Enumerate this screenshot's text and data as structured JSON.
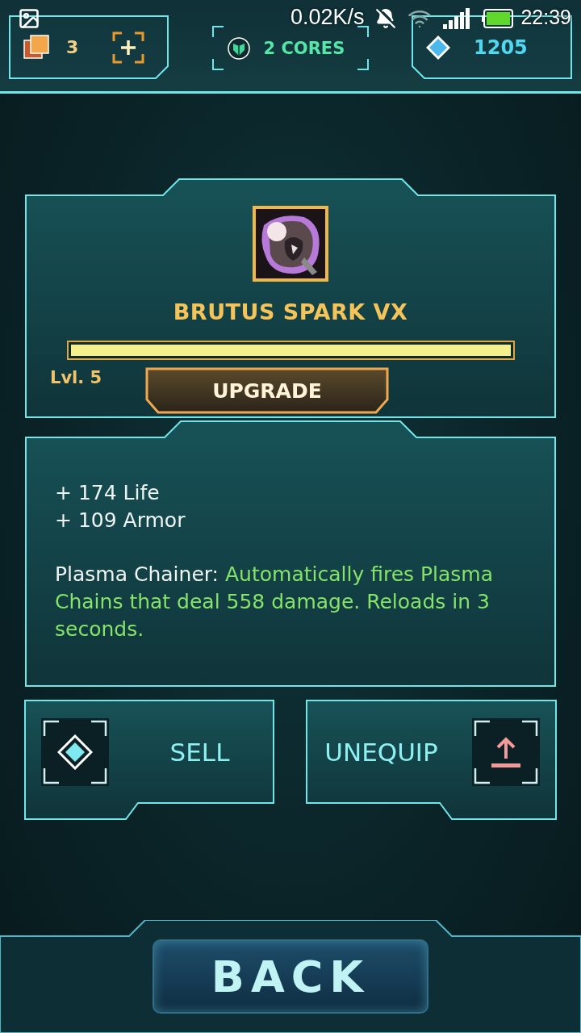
{
  "status_bar": {
    "network_speed": "0.02K/s",
    "time": "22:39"
  },
  "header": {
    "cards": "3",
    "cores": "2 CORES",
    "gems": "1205"
  },
  "item": {
    "name": "BRUTUS SPARK VX",
    "xp": {
      "level": 1.0
    },
    "level_label": "Lvl. 5",
    "upgrade_button": "UPGRADE"
  },
  "stats": {
    "bonuses": [
      "+ 174 Life",
      "+ 109 Armor"
    ],
    "ability": {
      "name": "Plasma Chainer:",
      "description": "Automatically fires Plasma Chains that deal 558 damage. Reloads in 3 seconds."
    }
  },
  "actions": [
    {
      "kind": "sell",
      "label": "SELL"
    },
    {
      "kind": "unequip",
      "label": "UNEQUIP"
    }
  ],
  "back_button": "BACK"
}
